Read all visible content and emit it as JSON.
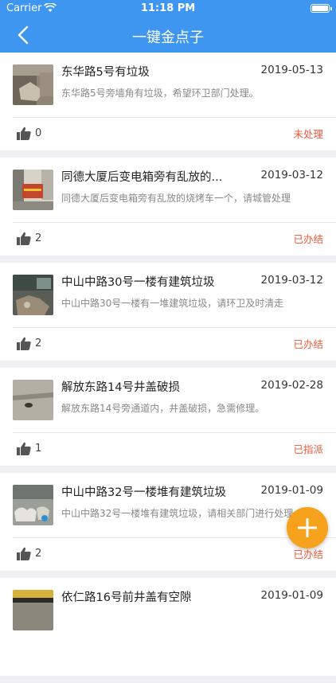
{
  "status_bar": {
    "carrier": "Carrier",
    "time": "11:18 PM"
  },
  "nav": {
    "title": "一键金点子"
  },
  "items": [
    {
      "title": "东华路5号有垃圾",
      "date": "2019-05-13",
      "desc": "东华路5号旁墙角有垃圾，希望环卫部门处理。",
      "likes": "0",
      "status": "未处理"
    },
    {
      "title": "同德大厦后变电箱旁有乱放的...",
      "date": "2019-03-12",
      "desc": "同德大厦后变电箱旁有乱放的烧烤车一个，请城管处理",
      "likes": "2",
      "status": "已办结"
    },
    {
      "title": "中山中路30号一楼有建筑垃圾",
      "date": "2019-03-12",
      "desc": "中山中路30号一楼有一堆建筑垃圾，请环卫及时清走",
      "likes": "2",
      "status": "已办结"
    },
    {
      "title": "解放东路14号井盖破损",
      "date": "2019-02-28",
      "desc": "解放东路14号旁通道内，井盖破损，急需修理。",
      "likes": "1",
      "status": "已指派"
    },
    {
      "title": "中山中路32号一楼堆有建筑垃圾",
      "date": "2019-01-09",
      "desc": "中山中路32号一楼堆有建筑垃圾，请相关部门进行处理",
      "likes": "2",
      "status": "已办结"
    },
    {
      "title": "依仁路16号前井盖有空隙",
      "date": "2019-01-09",
      "desc": "",
      "likes": "",
      "status": ""
    }
  ],
  "icons": {
    "back": "chevron-left-icon",
    "like": "thumbs-up-icon",
    "add": "plus-icon"
  },
  "colors": {
    "primary": "#3f96f0",
    "status": "#f0593a",
    "fab": "#f7a21c"
  }
}
